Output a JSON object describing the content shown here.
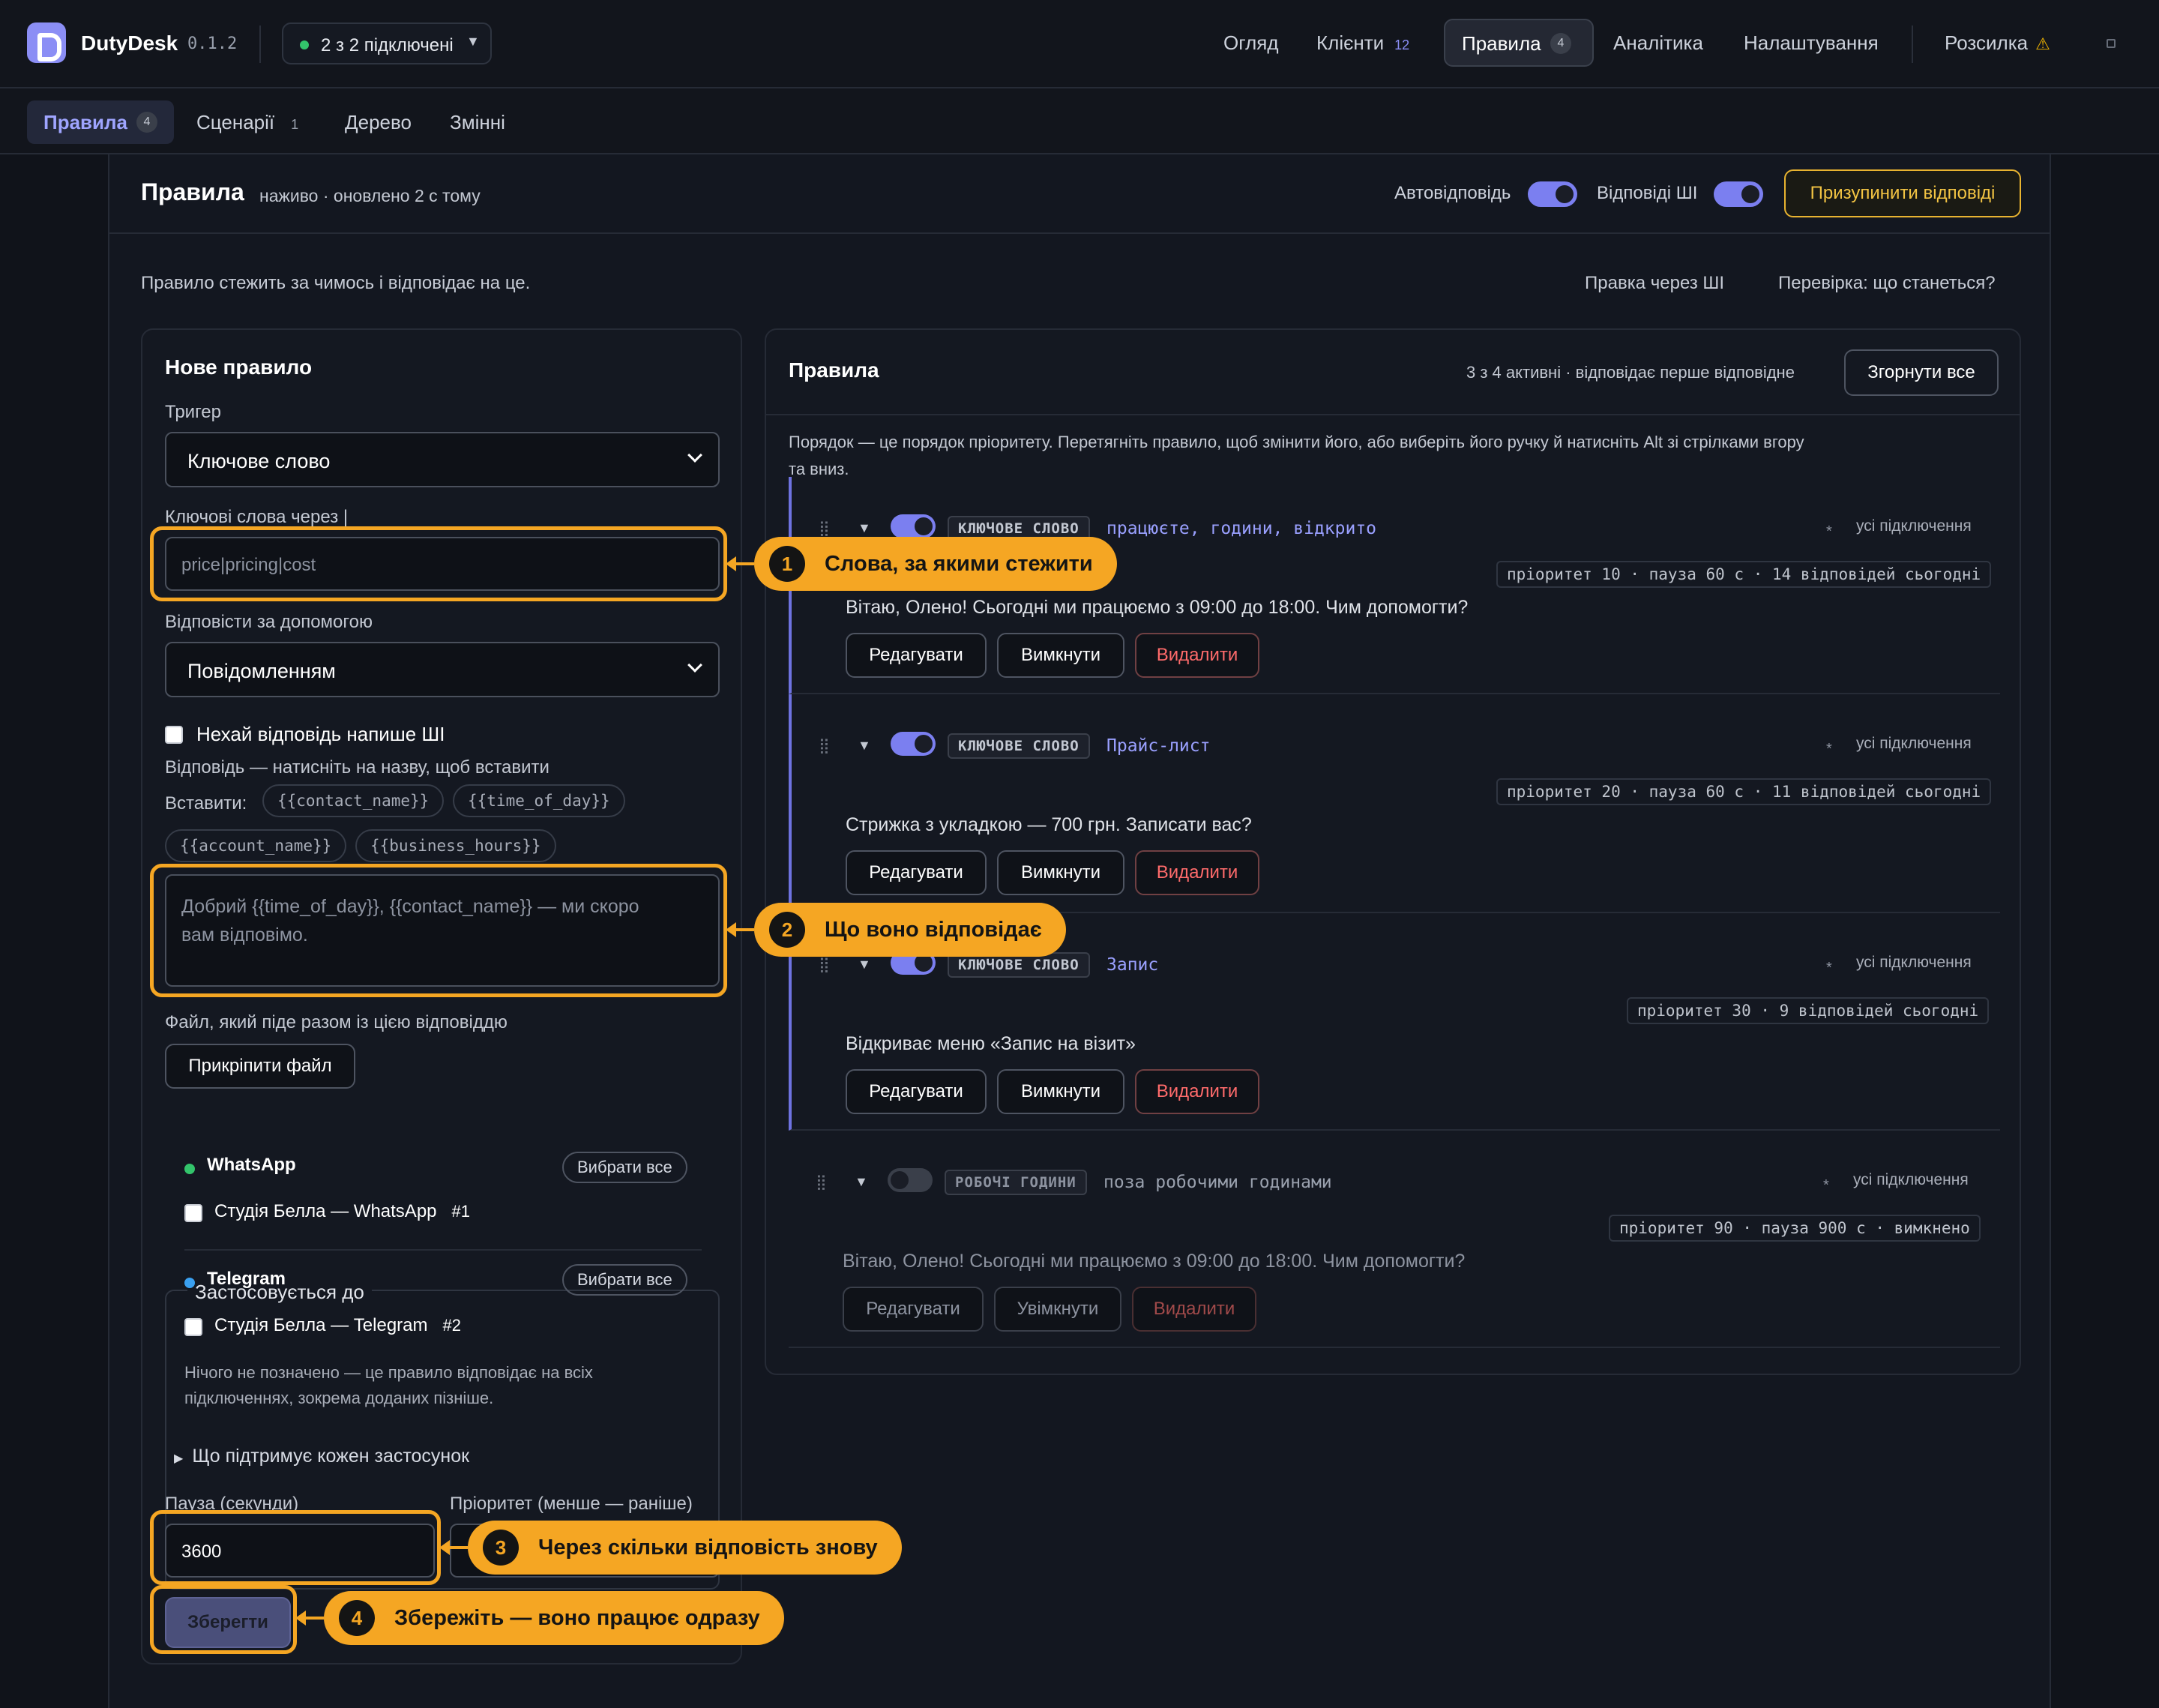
{
  "app": {
    "name": "DutyDesk",
    "version": "0.1.2",
    "connections": "2 з 2 підключені"
  },
  "topnav": {
    "overview": "Огляд",
    "clients": "Клієнти",
    "clients_badge": "12",
    "rules": "Правила",
    "rules_badge": "4",
    "analytics": "Аналітика",
    "settings": "Налаштування",
    "broadcast": "Розсилка",
    "broadcast_warn": "⚠"
  },
  "subnav": {
    "rules": "Правила",
    "rules_badge": "4",
    "scenarios": "Сценарії",
    "scenarios_badge": "1",
    "tree": "Дерево",
    "variables": "Змінні"
  },
  "header": {
    "title": "Правила",
    "status": "наживо · оновлено 2 с тому",
    "autoreply_label": "Автовідповідь",
    "autoreply_on": true,
    "ai_label": "Відповіді ШІ",
    "ai_on": true,
    "pause_label": "Призупинити відповіді"
  },
  "intro": "Правило стежить за чимось і відповідає на це.",
  "links": {
    "ai_edit": "Правка через ШІ",
    "check": "Перевірка: що станеться?"
  },
  "new_rule": {
    "title": "Нове правило",
    "trigger_label": "Тригер",
    "trigger_value": "Ключове слово",
    "keywords_label": "Ключові слова через |",
    "keywords_placeholder": "price|pricing|cost",
    "reply_with_label": "Відповісти за допомогою",
    "reply_with_value": "Повідомленням",
    "ai_checkbox": "Нехай відповідь напише ШІ",
    "reply_hint": "Відповідь — натисніть на назву, щоб вставити",
    "insert_label": "Вставити:",
    "vars": [
      "{{contact_name}}",
      "{{time_of_day}}",
      "{{account_name}}",
      "{{business_hours}}"
    ],
    "reply_placeholder_1": "Добрий {{time_of_day}}, {{contact_name}} — ми скоро",
    "reply_placeholder_2": "вам відповімо.",
    "file_label": "Файл, який піде разом із цією відповіддю",
    "attach_button": "Прикріпити файл",
    "applies_legend": "Застосовується до",
    "whatsapp": "WhatsApp",
    "whatsapp_color": "#33c46b",
    "whatsapp_account": "Студія Белла — WhatsApp",
    "whatsapp_num": "#1",
    "telegram": "Telegram",
    "telegram_color": "#3aa0f0",
    "telegram_account": "Студія Белла — Telegram",
    "telegram_num": "#2",
    "select_all": "Вибрати все",
    "none_note_1": "Нічого не позначено — це правило відповідає на всіх",
    "none_note_2": "підключеннях, зокрема доданих пізніше.",
    "support_summary": "Що підтримує кожен застосунок",
    "cooldown_label": "Пауза (секунди)",
    "cooldown_value": "3600",
    "priority_label": "Пріоритет (менше — раніше)",
    "save_button": "Зберегти"
  },
  "rules_list": {
    "title": "Правила",
    "summary": "3 з 4 активні · відповідає перше відповідне",
    "collapse_all": "Згорнути все",
    "description_1": "Порядок — це порядок пріоритету. Перетягніть правило, щоб змінити його, або виберіть його ручку й натисніть Alt зі стрілками вгору",
    "description_2": "та вниз.",
    "items": [
      {
        "kind": "КЛЮЧОВЕ СЛОВО",
        "keywords": "працюєте, години, відкрито",
        "scope": "усі підключення",
        "meta": "пріоритет 10 · пауза 60 с · 14 відповідей сьогодні",
        "reply": "Вітаю, Олено! Сьогодні ми працюємо з 09:00 до 18:00. Чим допомогти?",
        "edit": "Редагувати",
        "toggle": "Вимкнути",
        "delete": "Видалити",
        "on": true
      },
      {
        "kind": "КЛЮЧОВЕ СЛОВО",
        "keywords": "Прайс-лист",
        "scope": "усі підключення",
        "meta": "пріоритет 20 · пауза 60 с · 11 відповідей сьогодні",
        "reply": "Стрижка з укладкою — 700 грн. Записати вас?",
        "edit": "Редагувати",
        "toggle": "Вимкнути",
        "delete": "Видалити",
        "on": true
      },
      {
        "kind": "КЛЮЧОВЕ СЛОВО",
        "keywords": "Запис",
        "scope": "усі підключення",
        "meta": "пріоритет 30 · 9 відповідей сьогодні",
        "reply": "Відкриває меню «Запис на візит»",
        "edit": "Редагувати",
        "toggle": "Вимкнути",
        "delete": "Видалити",
        "on": true
      },
      {
        "kind": "РОБОЧІ ГОДИНИ",
        "keywords": "поза робочими годинами",
        "scope": "усі підключення",
        "meta": "пріоритет 90 · пауза 900 с · вимкнено",
        "reply": "Вітаю, Олено! Сьогодні ми працюємо з 09:00 до 18:00. Чим допомогти?",
        "edit": "Редагувати",
        "toggle": "Увімкнути",
        "delete": "Видалити",
        "on": false
      }
    ]
  },
  "tour": {
    "accent": "#f5a623",
    "steps": [
      {
        "n": "1",
        "text": "Слова, за якими стежити"
      },
      {
        "n": "2",
        "text": "Що воно відповідає"
      },
      {
        "n": "3",
        "text": "Через скільки відповість знову"
      },
      {
        "n": "4",
        "text": "Збережіть — воно працює одразу"
      }
    ]
  }
}
